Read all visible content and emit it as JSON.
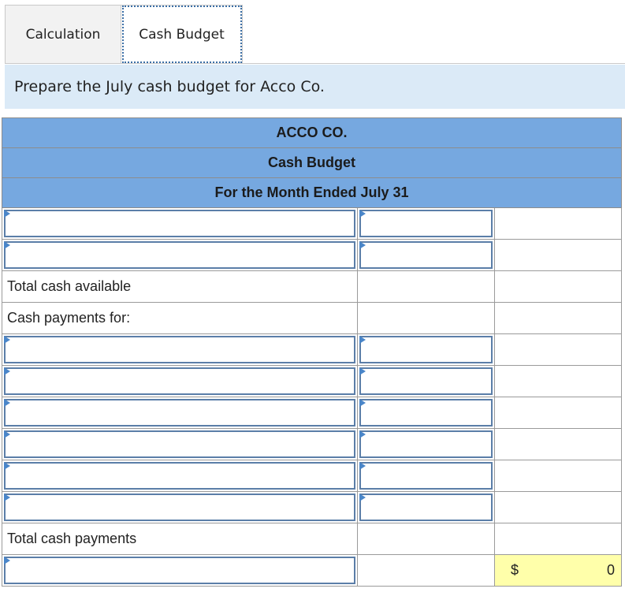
{
  "tabs": [
    {
      "label": "Calculation"
    },
    {
      "label": "Cash Budget"
    }
  ],
  "instruction": "Prepare the July cash budget for Acco Co.",
  "budget": {
    "company": "ACCO CO.",
    "title": "Cash Budget",
    "period": "For the Month Ended July 31",
    "labels": {
      "total_cash_available": "Total cash available",
      "cash_payments_for": "Cash payments for:",
      "total_cash_payments": "Total cash payments"
    },
    "final_row": {
      "currency": "$",
      "value": "0"
    }
  },
  "colors": {
    "header_bg": "#76a8e0",
    "instruction_bg": "#dbeaf7",
    "total_bg": "#ffffaa",
    "input_border": "#5b7ea8"
  }
}
